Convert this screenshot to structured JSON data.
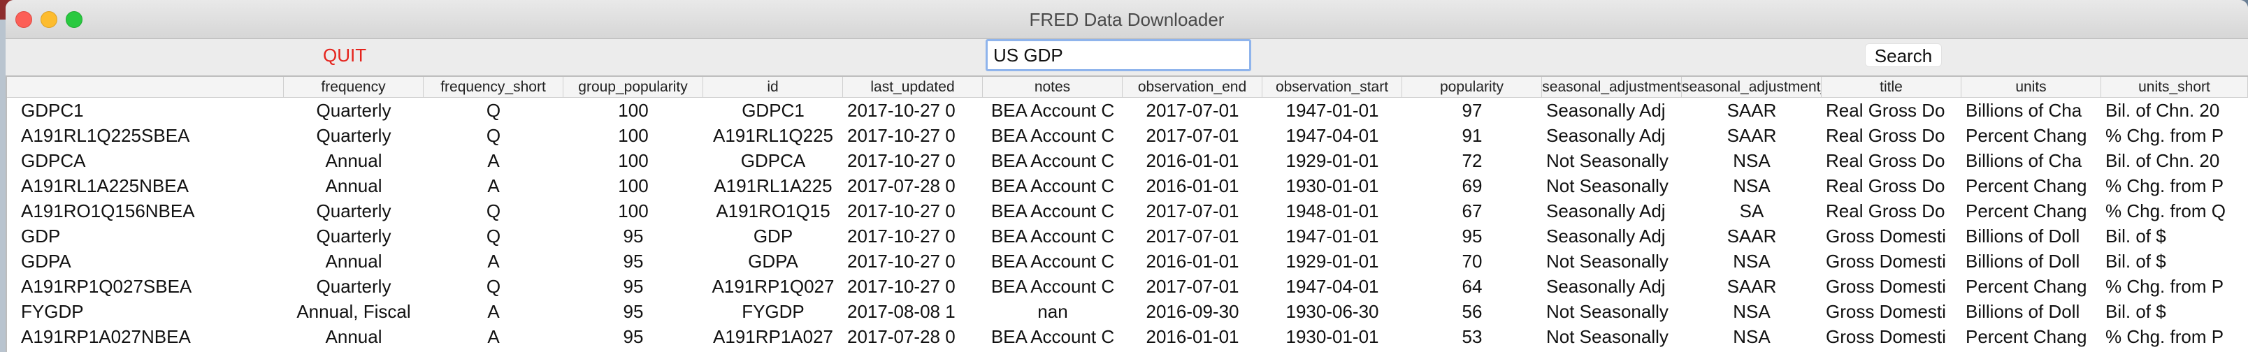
{
  "window": {
    "title": "FRED Data Downloader"
  },
  "toolbar": {
    "quit_label": "QUIT",
    "search_value": "US GDP",
    "search_label": "Search"
  },
  "table": {
    "columns": [
      "",
      "frequency",
      "frequency_short",
      "group_popularity",
      "id",
      "last_updated",
      "notes",
      "observation_end",
      "observation_start",
      "popularity",
      "seasonal_adjustment",
      "seasonal_adjustment_short",
      "title",
      "units",
      "units_short"
    ],
    "rows": [
      [
        "GDPC1",
        "Quarterly",
        "Q",
        "100",
        "GDPC1",
        "2017-10-27 0",
        "BEA Account C",
        "2017-07-01",
        "1947-01-01",
        "97",
        "Seasonally Adj",
        "SAAR",
        "Real Gross Do",
        "Billions of Cha",
        "Bil. of Chn. 20"
      ],
      [
        "A191RL1Q225SBEA",
        "Quarterly",
        "Q",
        "100",
        "A191RL1Q225",
        "2017-10-27 0",
        "BEA Account C",
        "2017-07-01",
        "1947-04-01",
        "91",
        "Seasonally Adj",
        "SAAR",
        "Real Gross Do",
        "Percent Chang",
        "% Chg. from P"
      ],
      [
        "GDPCA",
        "Annual",
        "A",
        "100",
        "GDPCA",
        "2017-10-27 0",
        "BEA Account C",
        "2016-01-01",
        "1929-01-01",
        "72",
        "Not Seasonally",
        "NSA",
        "Real Gross Do",
        "Billions of Cha",
        "Bil. of Chn. 20"
      ],
      [
        "A191RL1A225NBEA",
        "Annual",
        "A",
        "100",
        "A191RL1A225",
        "2017-07-28 0",
        "BEA Account C",
        "2016-01-01",
        "1930-01-01",
        "69",
        "Not Seasonally",
        "NSA",
        "Real Gross Do",
        "Percent Chang",
        "% Chg. from P"
      ],
      [
        "A191RO1Q156NBEA",
        "Quarterly",
        "Q",
        "100",
        "A191RO1Q15",
        "2017-10-27 0",
        "BEA Account C",
        "2017-07-01",
        "1948-01-01",
        "67",
        "Seasonally Adj",
        "SA",
        "Real Gross Do",
        "Percent Chang",
        "% Chg. from Q"
      ],
      [
        "GDP",
        "Quarterly",
        "Q",
        "95",
        "GDP",
        "2017-10-27 0",
        "BEA Account C",
        "2017-07-01",
        "1947-01-01",
        "95",
        "Seasonally Adj",
        "SAAR",
        "Gross Domesti",
        "Billions of Doll",
        "Bil. of $"
      ],
      [
        "GDPA",
        "Annual",
        "A",
        "95",
        "GDPA",
        "2017-10-27 0",
        "BEA Account C",
        "2016-01-01",
        "1929-01-01",
        "70",
        "Not Seasonally",
        "NSA",
        "Gross Domesti",
        "Billions of Doll",
        "Bil. of $"
      ],
      [
        "A191RP1Q027SBEA",
        "Quarterly",
        "Q",
        "95",
        "A191RP1Q027",
        "2017-10-27 0",
        "BEA Account C",
        "2017-07-01",
        "1947-04-01",
        "64",
        "Seasonally Adj",
        "SAAR",
        "Gross Domesti",
        "Percent Chang",
        "% Chg. from P"
      ],
      [
        "FYGDP",
        "Annual, Fiscal",
        "A",
        "95",
        "FYGDP",
        "2017-08-08 1",
        "nan",
        "2016-09-30",
        "1930-06-30",
        "56",
        "Not Seasonally",
        "NSA",
        "Gross Domesti",
        "Billions of Doll",
        "Bil. of $"
      ],
      [
        "A191RP1A027NBEA",
        "Annual",
        "A",
        "95",
        "A191RP1A027",
        "2017-07-28 0",
        "BEA Account C",
        "2016-01-01",
        "1930-01-01",
        "53",
        "Not Seasonally",
        "NSA",
        "Gross Domesti",
        "Percent Chang",
        "% Chg. from P"
      ]
    ]
  }
}
